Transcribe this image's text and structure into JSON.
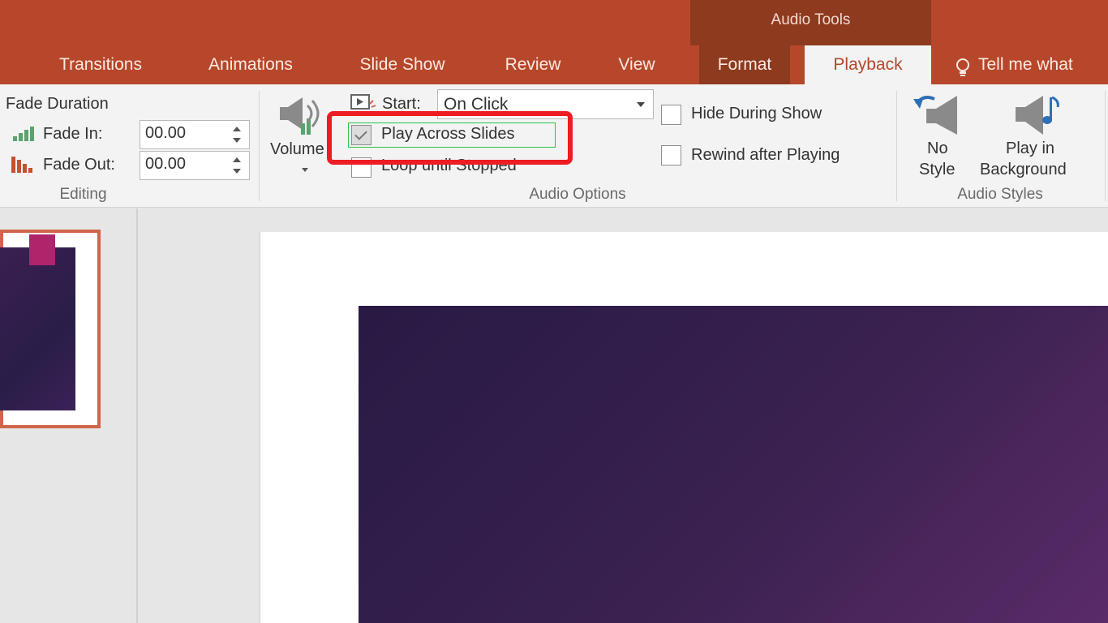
{
  "context": {
    "label": "Audio Tools"
  },
  "tabs": {
    "transitions": "Transitions",
    "animations": "Animations",
    "slide_show": "Slide Show",
    "review": "Review",
    "view": "View",
    "format": "Format",
    "playback": "Playback",
    "tell_me": "Tell me what"
  },
  "editing": {
    "heading": "Fade Duration",
    "fade_in_label": "Fade In:",
    "fade_in_value": "00.00",
    "fade_out_label": "Fade Out:",
    "fade_out_value": "00.00",
    "group_label": "Editing"
  },
  "audio_options": {
    "volume_label": "Volume",
    "start_label": "Start:",
    "start_value": "On Click",
    "play_across_slides": "Play Across Slides",
    "play_across_slides_checked": true,
    "loop_until_stopped": "Loop until Stopped",
    "hide_during_show": "Hide During Show",
    "rewind_after_playing": "Rewind after Playing",
    "group_label": "Audio Options"
  },
  "audio_styles": {
    "no_style_line1": "No",
    "no_style_line2": "Style",
    "play_bg_line1": "Play in",
    "play_bg_line2": "Background",
    "group_label": "Audio Styles"
  },
  "colors": {
    "ribbon_accent": "#b7472a",
    "context_band": "#8e3a1f",
    "highlight": "#ee1c23"
  }
}
